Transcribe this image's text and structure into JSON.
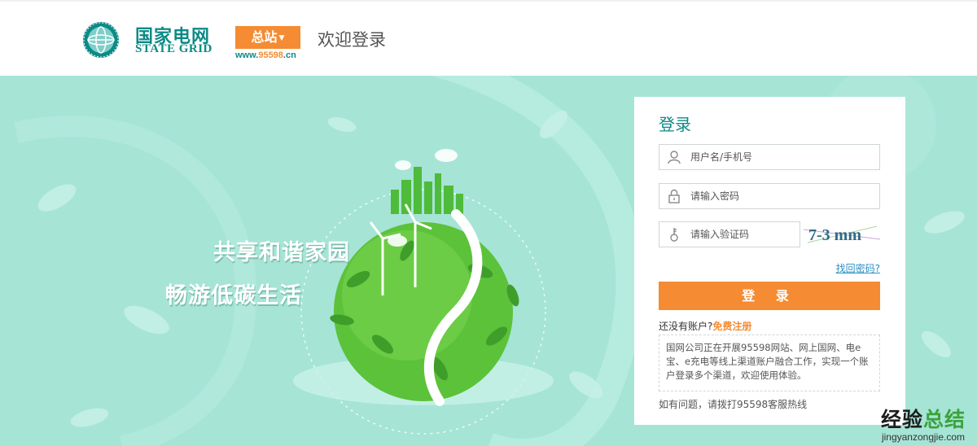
{
  "header": {
    "logo_cn": "国家电网",
    "logo_en": "STATE GRID",
    "station_label": "总站",
    "station_url_prefix": "www.",
    "station_url_num": "95598",
    "station_url_suffix": ".cn",
    "welcome": "欢迎登录"
  },
  "banner": {
    "slogan_line1": "共享和谐家园",
    "slogan_line2": "畅游低碳生活"
  },
  "login": {
    "title": "登录",
    "username_placeholder": "用户名/手机号",
    "password_placeholder": "请输入密码",
    "captcha_placeholder": "请输入验证码",
    "captcha_text": "7-3 mm",
    "forgot": "找回密码?",
    "submit": "登 录",
    "no_account": "还没有账户?",
    "register": "免费注册",
    "notice": "国网公司正在开展95598网站、网上国网、电e宝、e充电等线上渠道账户融合工作，实现一个账户登录多个渠道，欢迎使用体验。",
    "help": "如有问题，请拨打95598客服热线"
  },
  "watermark": {
    "title_a": "经验",
    "title_b": "总结",
    "url": "jingyanzongjie.com"
  },
  "colors": {
    "brand_teal": "#0c8a86",
    "accent_orange": "#f58b32",
    "banner_bg": "#a6e4d6",
    "globe_green": "#5cc23a"
  }
}
